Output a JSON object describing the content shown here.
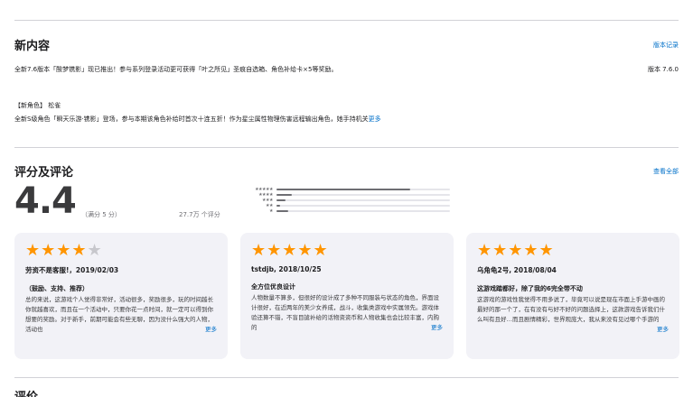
{
  "whats_new": {
    "title": "新内容",
    "history_link": "版本记录",
    "line1": "全新7.6版本「酸梦镌影」现已推出！参与系列登录活动更可获得「叶之所见」圣痕自选箱、角色补给卡×5等奖励。",
    "version": "版本 7.6.0",
    "line2": "【新角色】 松雀",
    "line3": "全新S级角色「瞬天乐游·镌影」登场，参与本期该角色补给时首次十连五折！作为星尘属性物理伤害远程输出角色，她手持机关",
    "more": "更多"
  },
  "ratings": {
    "title": "评分及评论",
    "see_all": "查看全部",
    "score": "4.4",
    "out_of": "（满分 5 分）",
    "count": "27.7万 个评分",
    "distribution": [
      {
        "stars": "★★★★★",
        "fraction": 0.77
      },
      {
        "stars": "★★★★",
        "fraction": 0.09
      },
      {
        "stars": "★★★",
        "fraction": 0.05
      },
      {
        "stars": "★★",
        "fraction": 0.02
      },
      {
        "stars": "★",
        "fraction": 0.07
      }
    ]
  },
  "reviews": [
    {
      "stars_full": "★★★★",
      "stars_empty": "★",
      "author": "劳资不是客服!，2019/02/03",
      "title": "（鼓励、支持、推荐）",
      "body": "总的来说，这游戏个人觉得非常好，活动很多，奖励很多，玩的时间越长你就越喜欢，而且在一个活动中，只要你花一点时间，就一定可以得到你想要的奖励。对于新手，前期可能会有些无聊，因为没什么强大的人物，活动也",
      "more": "更多"
    },
    {
      "stars_full": "★★★★★",
      "stars_empty": "",
      "author": "tstdjb, 2018/10/25",
      "title": "全方位优良设计",
      "body": "人物数量不算多，但很好的设计成了多种不同服装与状态的角色，界面设计很好，在近两年的美少女养成，战斗，收集类游戏中实属领先。游戏体验还算不错，不盲目搶补给的话物资资币和人物收集也会比较丰富，内购的",
      "more": "更多"
    },
    {
      "stars_full": "★★★★★",
      "stars_empty": "",
      "author": "乌角龟2号, 2018/08/04",
      "title": "这游戏踏都好，除了我的6完全带不动",
      "body": "这游戏的游戏性我觉得不用多说了，毕竟可以说是现在市面上手游中画的最好的那一个了，在有没有与好不好的问题选择上，这款游戏告诉我们什么叫有且好…而且剧情精彩，世界观庞大，我从来没有见过哪个手游的",
      "more": "更多"
    }
  ],
  "next_section": {
    "title": "评价"
  }
}
